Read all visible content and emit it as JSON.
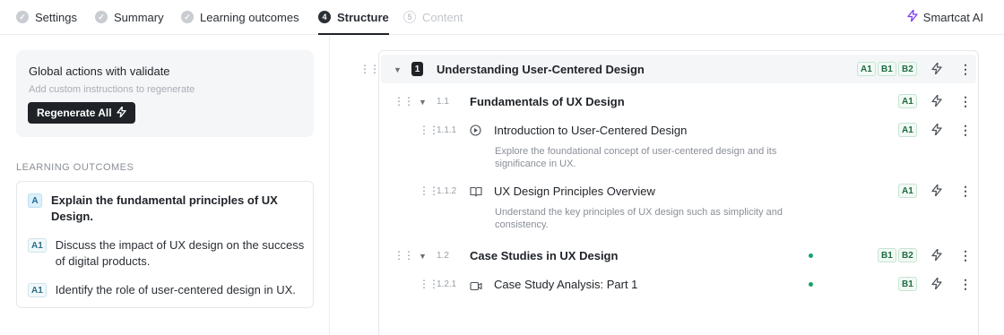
{
  "nav": {
    "steps": [
      {
        "label": "Settings",
        "state": "done"
      },
      {
        "label": "Summary",
        "state": "done"
      },
      {
        "label": "Learning outcomes",
        "state": "done"
      },
      {
        "label": "Structure",
        "state": "current",
        "num": "4"
      },
      {
        "label": "Content",
        "state": "disabled",
        "num": "5"
      }
    ],
    "ai_label": "Smartcat AI"
  },
  "global_actions": {
    "title": "Global actions with validate",
    "placeholder": "Add custom instructions to regenerate",
    "button_label": "Regenerate All"
  },
  "learning_outcomes": {
    "heading": "LEARNING OUTCOMES",
    "items": [
      {
        "badge": "A",
        "text": "Explain the fundamental principles of UX Design."
      },
      {
        "badge": "A1",
        "text": "Discuss the impact of UX design on the success of digital products."
      },
      {
        "badge": "A1",
        "text": "Identify the role of user-centered design in UX."
      }
    ]
  },
  "structure": {
    "section": {
      "num": "1",
      "title": "Understanding User-Centered Design",
      "levels": [
        "A1",
        "B1",
        "B2"
      ]
    },
    "rows": [
      {
        "num": "1.1",
        "title": "Fundamentals of UX Design",
        "levels": [
          "A1"
        ]
      },
      {
        "num": "1.1.1",
        "icon": "play-icon",
        "title": "Introduction to User-Centered Design",
        "desc": "Explore the foundational concept of user-centered design and its significance in UX.",
        "levels": [
          "A1"
        ]
      },
      {
        "num": "1.1.2",
        "icon": "book-icon",
        "title": "UX Design Principles Overview",
        "desc": "Understand the key principles of UX design such as simplicity and consistency.",
        "levels": [
          "A1"
        ]
      },
      {
        "num": "1.2",
        "title": "Case Studies in UX Design",
        "levels": [
          "B1",
          "B2"
        ]
      },
      {
        "num": "1.2.1",
        "icon": "video-icon",
        "title": "Case Study Analysis: Part 1",
        "levels": [
          "B1"
        ]
      }
    ]
  },
  "colors": {
    "accent": "#7b3ff2",
    "dark": "#1f2328",
    "status_dot": "#1aa36a",
    "level_badge": "#1f6b42"
  }
}
